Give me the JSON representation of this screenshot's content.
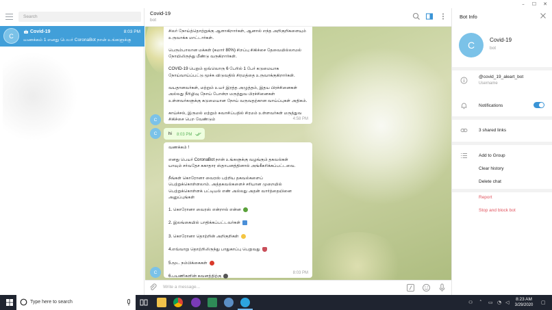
{
  "window": {
    "controls": [
      "–",
      "☐",
      "✕"
    ]
  },
  "sidebar": {
    "search_placeholder": "Search",
    "chat": {
      "avatar_letter": "C",
      "name": "Covid-19",
      "time": "8:03 PM",
      "preview": "வணக்கம் 1   எனது பெயர் CoronaBot நான் உங்களுக்கு"
    }
  },
  "header": {
    "title": "Covid-19",
    "subtitle": "bot"
  },
  "messages": {
    "m1": {
      "paragraphs": [
        "சிலர் நோய்த்தொற்றுக்கு ஆளாகிறார்கள், ஆனால் எந்த அறிகுறிகளையும் உருவாக்க மாட்டார்கள்.",
        "பெரும்பாலான மக்கள் (சுமார் 80%) சிறப்பு சிகிச்சை தேவையில்லாமல் நோயிலிருந்து மீண்டு வருகிறார்கள்.",
        "COVID-19 பெறும் ஒவ்வொரு 6 பேரில் 1 பேர் கடுமையாக நோய்வாய்ப்பட்டு மூச்சு விடுவதில் சிரமத்தை உருவாக்குகிறார்கள்.",
        "வயதானவர்கள், மற்றும் உயர் இரத்த அழுத்தம், இதய பிரச்சினைகள் அல்லது நீரிழிவு நோய் போன்ற மருத்துவ பிரச்சினைகள் உள்ளவர்களுக்கு கடுமையான நோய் வருவதற்கான வாய்ப்புகள் அதிகம்.",
        "காய்ச்சல், இருமல் மற்றும் சுவாசிப்பதில் சிரமம் உள்ளவர்கள் மருத்துவ சிகிச்சை பெற வேண்டும்"
      ],
      "time": "4:58 PM",
      "avatar": "C"
    },
    "m2": {
      "text": "hi",
      "time": "8:03 PM",
      "avatar": "C"
    },
    "m3": {
      "greeting": "வணக்கம் !",
      "intro": [
        "எனது பெயர் CoronaBot நான் உங்களுக்கு வழங்கும் தகவல்கள்",
        "யாவும் சர்வதேச சுகாதார ஸ்தாபனத்தினால் அங்கீகரிக்கப்பட்டவை."
      ],
      "body": [
        "நீங்கள் கொரோனா வைரஸ் பற்றிய தகவல்களைப்",
        "பெற்றுக்கொள்ளலாம். அத்தகவல்களைச் சரியான முறையில்",
        "பெற்றுக்கொள்ளக் பட்டியல் எண் அல்லது அதன் வார்த்தையினை",
        "அனுப்புங்கள்"
      ],
      "items": [
        {
          "text": "1. கொரோனா வைரஸ் என்றால் என்ன",
          "emoji_color": "#5aa13a"
        },
        {
          "text": "2. இலங்கையில் பாதிக்கப்பட்டவர்கள்",
          "emoji_color": "#4a8fd8"
        },
        {
          "text": "3. கொரோனா தொற்றின் அறிகுறிகள்",
          "emoji_color": "#f4c542"
        },
        {
          "text": "4.எவ்வாறு தொற்றிலிருந்து பாதுகாப்பு பெறுவது",
          "emoji_color": "#c94f5a"
        },
        {
          "text": "5.மூட நம்பிக்கைகள்",
          "emoji_color": "#d93a2b"
        },
        {
          "text": "6.பயணிகளின் கவனத்திற்கு",
          "emoji_color": "#555555"
        }
      ],
      "time": "8:03 PM",
      "avatar": "C"
    }
  },
  "composer": {
    "placeholder": "Write a message..."
  },
  "bot_info": {
    "title": "Bot Info",
    "avatar": "C",
    "name": "Covid-19",
    "subtitle": "bot",
    "username_value": "@covid_19_aleart_bot",
    "username_label": "Username",
    "notifications_label": "Notifications",
    "notifications_on": true,
    "shared_links": "3 shared links",
    "actions": [
      "Add to Group",
      "Clear history",
      "Delete chat"
    ],
    "danger_actions": [
      "Report",
      "Stop and block bot"
    ]
  },
  "taskbar": {
    "search_placeholder": "Type here to search",
    "time": "8:23 AM",
    "date": "3/29/2020"
  },
  "colors": {
    "accent": "#419fd9",
    "avatar": "#7bc2e8",
    "outgoing": "#eefedf",
    "danger": "#e0535e",
    "taskbar": "#1f2430"
  }
}
